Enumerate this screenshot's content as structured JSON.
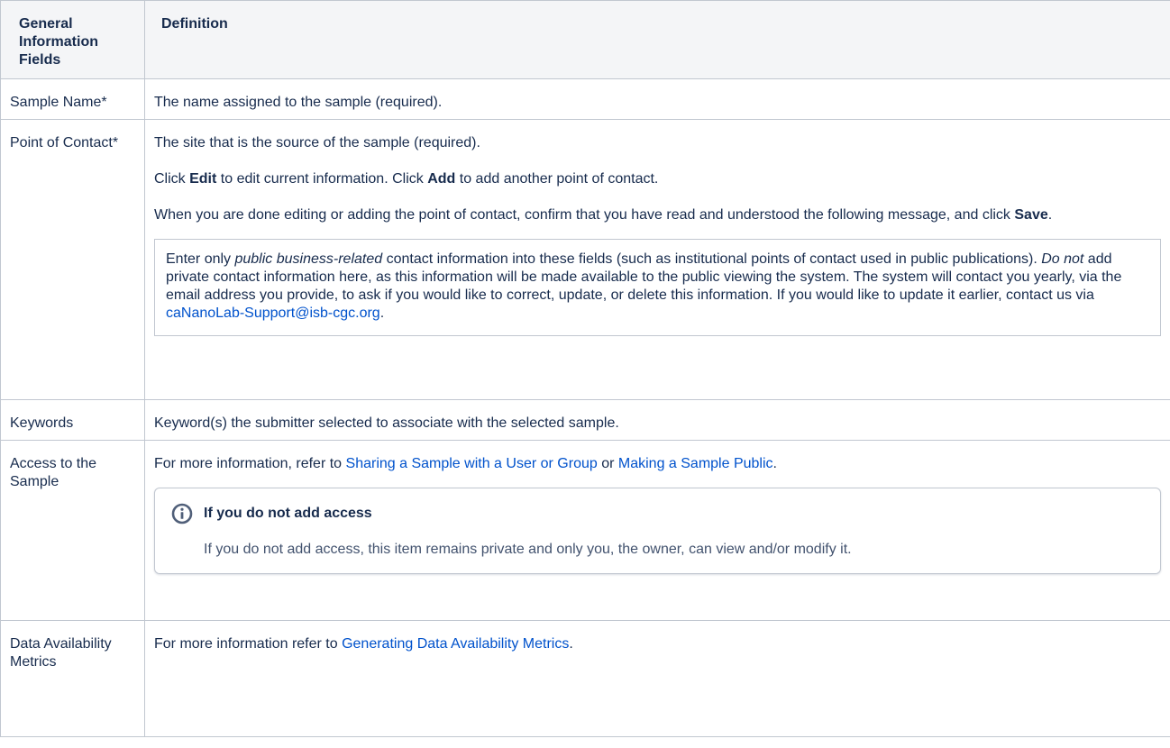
{
  "table": {
    "headers": {
      "fields": "General Information Fields",
      "definition": "Definition"
    },
    "rows": {
      "sample_name": {
        "field": "Sample Name*",
        "definition": "The name assigned to the sample (required)."
      },
      "point_of_contact": {
        "field": "Point of Contact*",
        "p1": "The site that is the source of the sample (required).",
        "p2_click1": "Click ",
        "p2_edit": "Edit",
        "p2_mid": " to edit current information. Click ",
        "p2_add": "Add",
        "p2_end": " to add another point of contact.",
        "p3_start": "When you are done editing or adding the point of contact, confirm that you have read and understood the following message, and click ",
        "p3_save": "Save",
        "p3_end": ".",
        "panel": {
          "t1": "Enter only ",
          "em1": "public business-related",
          "t2": " contact information into these fields (such as institutional points of contact used in public publications). ",
          "em2": "Do not",
          "t3": " add private contact information here, as this information will be made available to the public viewing the system. The system will contact you yearly, via the email address you provide, to ask if you would like to correct, update, or delete this information. If you would like to update it earlier, contact us via ",
          "link": "caNanoLab-Support@isb-cgc.org",
          "t4": "."
        }
      },
      "keywords": {
        "field": "Keywords",
        "definition": "Keyword(s) the submitter selected to associate with the selected sample."
      },
      "access": {
        "field": "Access to the Sample",
        "t1": "For more information, refer to ",
        "link1": "Sharing a Sample with a User or Group",
        "t2": " or ",
        "link2": "Making a Sample Public",
        "t3": ".",
        "info": {
          "icon": "info-icon",
          "title": "If you do not add access",
          "body": "If you do not add access, this item remains private and only you, the owner, can view and/or modify it."
        }
      },
      "data_availability": {
        "field": "Data Availability Metrics",
        "t1": "For more information refer to ",
        "link": "Generating Data Availability Metrics",
        "t2": "."
      }
    }
  },
  "colors": {
    "link": "#0052cc",
    "border": "#c1c7d0",
    "header_bg": "#f4f5f7",
    "text": "#172b4d"
  }
}
